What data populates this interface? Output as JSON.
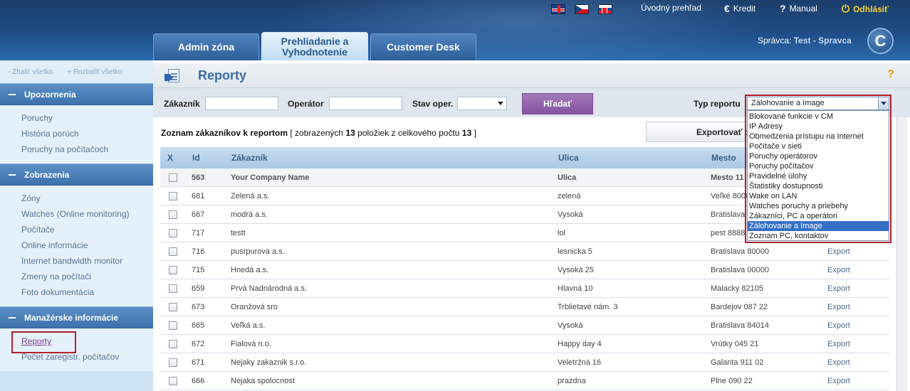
{
  "header": {
    "links": {
      "uvodny": "Úvodný prehľad",
      "kredit": "Kredit",
      "manual": "Manual",
      "odhlasit": "Odhlásiť"
    },
    "tabs": [
      "Admin zóna",
      "Prehliadanie a Vyhodnotenie",
      "Customer Desk"
    ],
    "admin_prefix": "Správca:",
    "admin_name": "Test - Spravca",
    "logo_letter": "C",
    "flags": [
      "en-flag-icon",
      "cz-flag-icon",
      "sk-flag-icon"
    ]
  },
  "sidebar": {
    "collapse_all": "- Zbaliť všetko",
    "expand_all": "+ Rozbaliť všetko",
    "sections": [
      {
        "title": "Upozornenia",
        "items": [
          "Poruchy",
          "História porúch",
          "Poruchy na počítačoch"
        ]
      },
      {
        "title": "Zobrazenia",
        "items": [
          "Zóny",
          "Watches (Online monitoring)",
          "Počítače",
          "Online informácie",
          "Internet bandwidth monitor",
          "Zmeny na počítači",
          "Foto dokumentácia"
        ]
      },
      {
        "title": "Manažérske informácie",
        "items": [
          "Reporty",
          "Počet zaregistr. počítačov"
        ]
      }
    ]
  },
  "main": {
    "title": "Reporty",
    "help": "?",
    "filters": {
      "zakaznik_label": "Zákazník",
      "operator_label": "Operátor",
      "stav_label": "Stav oper.",
      "search_button": "Hľadať",
      "typ_label": "Typ reportu",
      "typ_selected": "Zálohovanie a Image"
    },
    "typ_options": [
      "Blokované funkcie v CM",
      "IP Adresy",
      "Obmedzenia prístupu na Internet",
      "Počítače v sieti",
      "Poruchy operátorov",
      "Poruchy počítačov",
      "Pravidelné úlohy",
      "Štatistiky dostupnosti",
      "Wake on LAN",
      "Watches poruchy a priebehy",
      "Zákazníci, PC a operátori",
      "Zálohovanie a Image",
      "Zoznam PC, kontaktov"
    ],
    "list_info": {
      "prefix": "Zoznam zákazníkov k reportom",
      "middle": "[ zobrazených",
      "shown": "13",
      "mid2": "položiek z celkového počtu",
      "total": "13",
      "suffix": "]"
    },
    "export_button": "Exportovať do",
    "columns": [
      "X",
      "Id",
      "Zákazník",
      "Ulica",
      "Mesto"
    ],
    "rows": [
      {
        "id": "563",
        "name": "Your Company Name",
        "street": "Ulica",
        "city": "Mesto 11",
        "export": ""
      },
      {
        "id": "681",
        "name": "Zelená a.s.",
        "street": "zelená",
        "city": "Veľké 8000",
        "export": ""
      },
      {
        "id": "667",
        "name": "modrá a.s.",
        "street": "Vysoká",
        "city": "Bratislava",
        "export": ""
      },
      {
        "id": "717",
        "name": "testt",
        "street": "lol",
        "city": "pest 8888",
        "export": ""
      },
      {
        "id": "716",
        "name": "pusrpurova a.s.",
        "street": "lesnicka 5",
        "city": "Bratislava 80000",
        "export": "Export"
      },
      {
        "id": "715",
        "name": "Hnedá a.s.",
        "street": "Vysoká 25",
        "city": "Bratislava 00000",
        "export": "Export"
      },
      {
        "id": "659",
        "name": "Prvá Nadnárodná a.s.",
        "street": "Hlavná 10",
        "city": "Malacky 82105",
        "export": "Export"
      },
      {
        "id": "673",
        "name": "Oranžová sro",
        "street": "Trblietavé nám. 3",
        "city": "Bardejov 087 22",
        "export": "Export"
      },
      {
        "id": "665",
        "name": "Veľká a.s.",
        "street": "Vysoká",
        "city": "Bratislava 84014",
        "export": "Export"
      },
      {
        "id": "672",
        "name": "Fialová n.o.",
        "street": "Happy day 4",
        "city": "Vrútky 045 21",
        "export": "Export"
      },
      {
        "id": "671",
        "name": "Nejaky zakaznik s.r.o.",
        "street": "Veletržná 16",
        "city": "Galanta 911 02",
        "export": "Export"
      },
      {
        "id": "666",
        "name": "Nejaka spolocnost",
        "street": "prazdna",
        "city": "Plne 090 22",
        "export": "Export"
      }
    ]
  }
}
